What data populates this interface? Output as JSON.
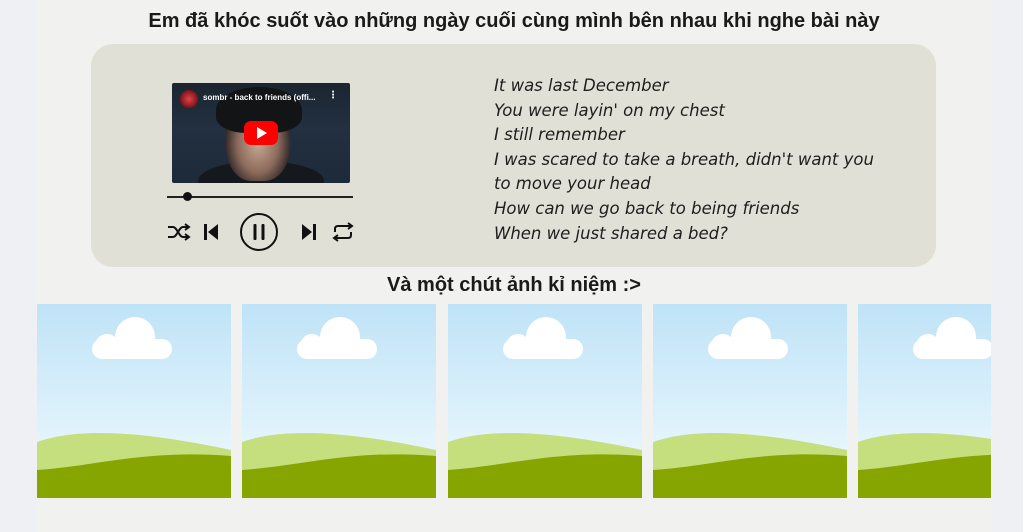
{
  "header": {
    "title": "Em đã khóc suốt vào những ngày cuối cùng mình bên nhau khi nghe bài này"
  },
  "player": {
    "video_title": "sombr - back to friends (offi...",
    "video_menu": "⋮",
    "progress_fraction": 0.11
  },
  "lyrics": {
    "lines": [
      "It was last December",
      "You were layin' on my chest",
      "I still remember",
      "I was scared to take a breath, didn't want you",
      "to move your head",
      "How can we go back to being friends",
      "When we just shared a bed?"
    ]
  },
  "gallery": {
    "title": "Và một chút ảnh kỉ niệm :>",
    "photo_count": 5
  },
  "colors": {
    "card": "#e0e0d6",
    "sky_top": "#bfe3f7",
    "grass": "#87a500",
    "youtube_red": "#ff0000"
  }
}
